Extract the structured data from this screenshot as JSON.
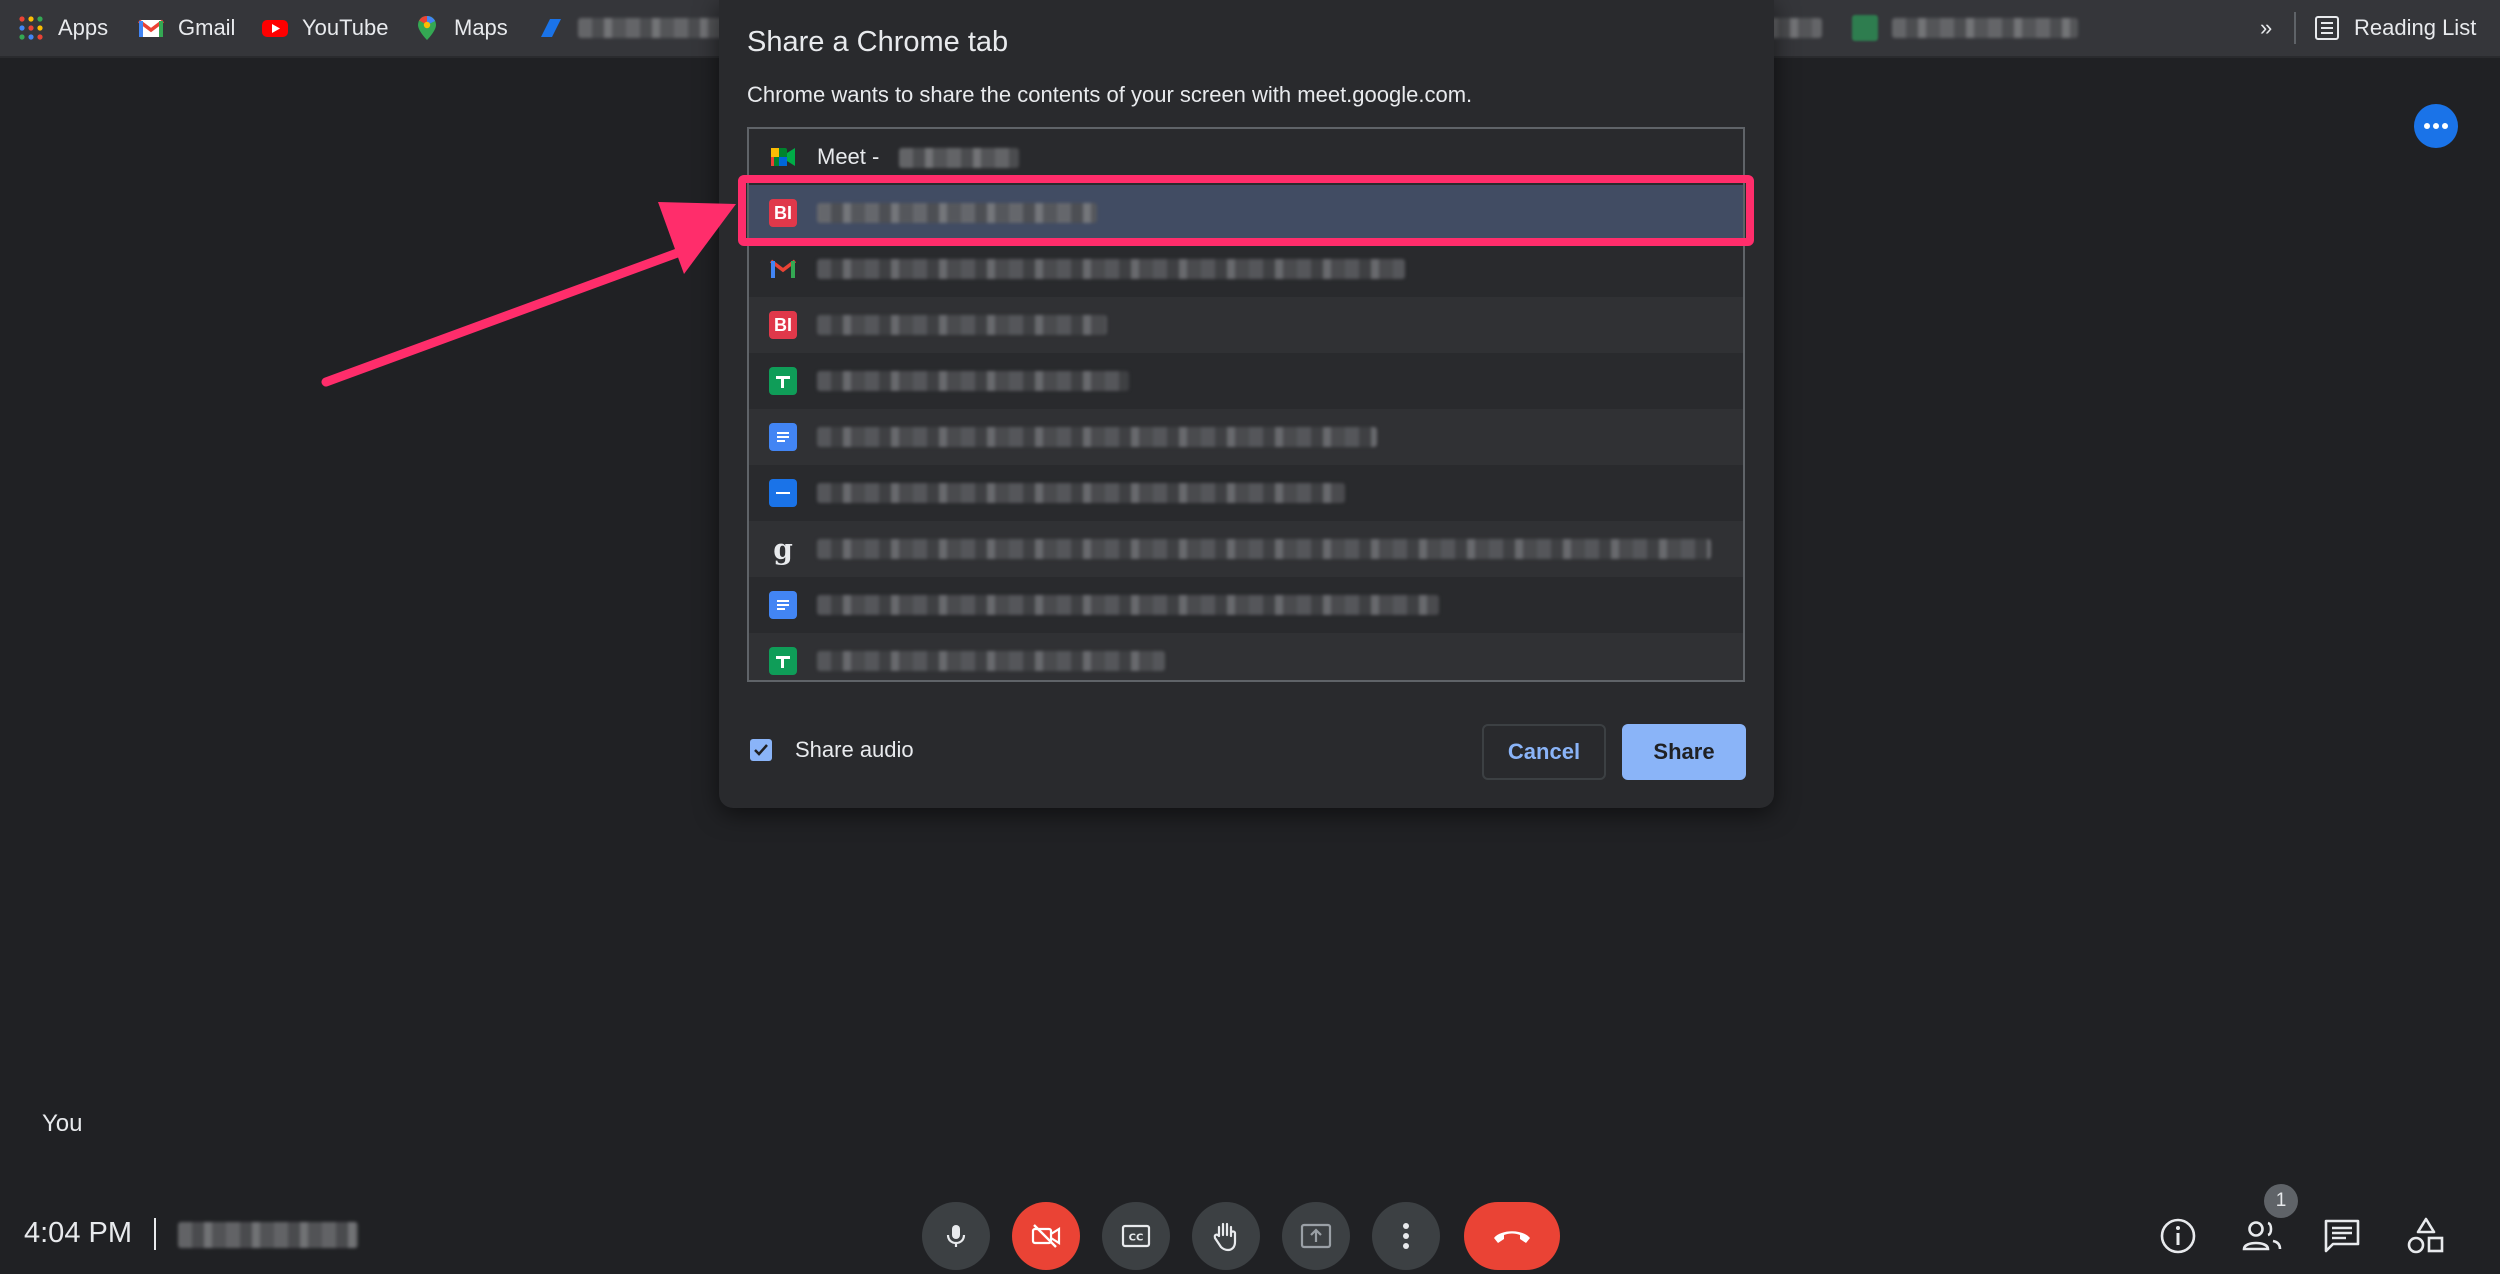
{
  "bookmarks": {
    "items": [
      {
        "label": "Apps",
        "icon": "apps-grid-icon"
      },
      {
        "label": "Gmail",
        "icon": "gmail-icon"
      },
      {
        "label": "YouTube",
        "icon": "youtube-icon"
      },
      {
        "label": "Maps",
        "icon": "maps-icon"
      }
    ],
    "overflow": "»",
    "reading_list": "Reading List"
  },
  "dialog": {
    "title": "Share a Chrome tab",
    "description": "Chrome wants to share the contents of your screen with meet.google.com.",
    "tabs": [
      {
        "label": "Meet -",
        "icon": "meet-icon",
        "selected": false
      },
      {
        "label": "",
        "icon": "bi-icon",
        "selected": true
      },
      {
        "label": "",
        "icon": "gmail-icon",
        "selected": false
      },
      {
        "label": "",
        "icon": "bi-icon",
        "selected": false
      },
      {
        "label": "",
        "icon": "sheets-icon",
        "selected": false
      },
      {
        "label": "",
        "icon": "docs-icon",
        "selected": false
      },
      {
        "label": "",
        "icon": "generic-blue-icon",
        "selected": false
      },
      {
        "label": "",
        "icon": "goodreads-g-icon",
        "selected": false
      },
      {
        "label": "",
        "icon": "docs-icon",
        "selected": false
      },
      {
        "label": "",
        "icon": "sheets-icon",
        "selected": false
      }
    ],
    "share_audio_label": "Share audio",
    "share_audio_checked": true,
    "cancel_label": "Cancel",
    "share_label": "Share"
  },
  "meet": {
    "self_label": "You",
    "time": "4:04 PM",
    "participant_count": "1"
  },
  "colors": {
    "accent_blue": "#8ab4f8",
    "highlight_pink": "#ff2d6b",
    "danger_red": "#ea4335",
    "background": "#202124"
  }
}
